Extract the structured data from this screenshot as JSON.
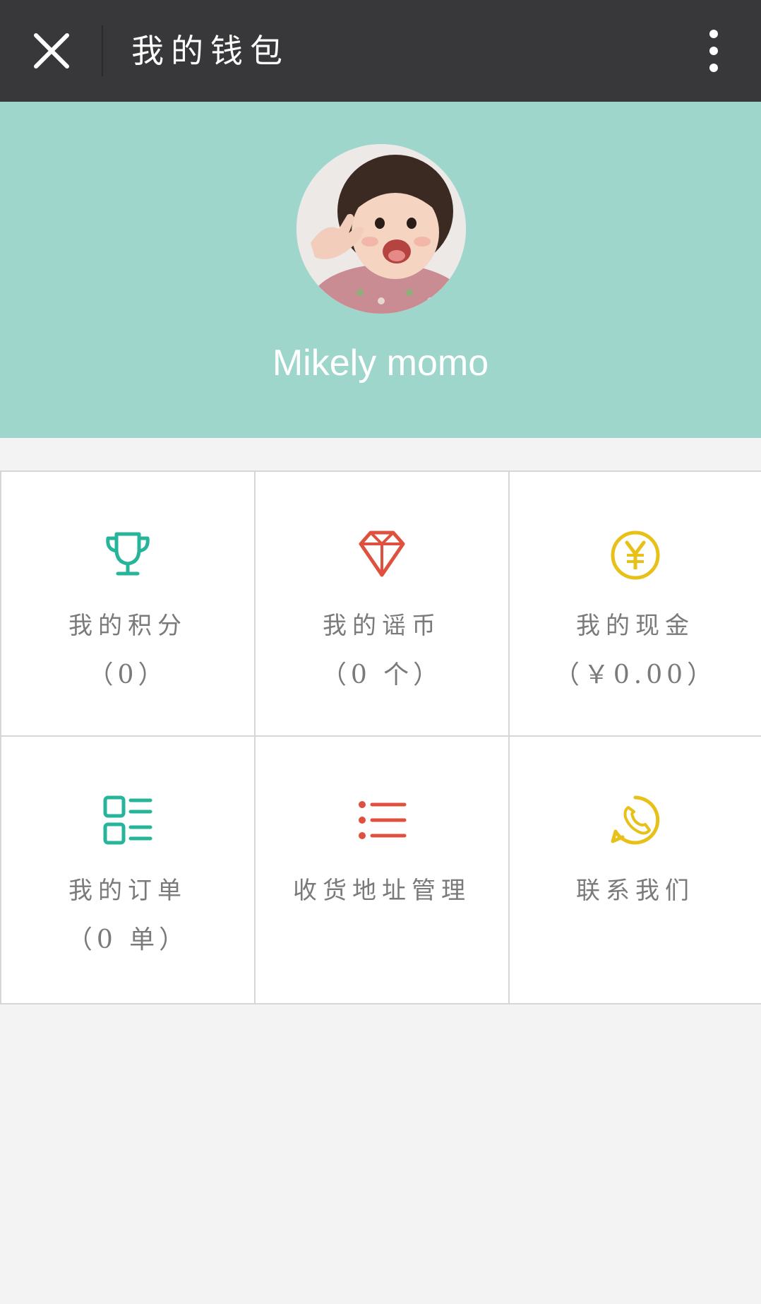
{
  "header": {
    "title": "我的钱包"
  },
  "profile": {
    "username": "Mikely momo"
  },
  "grid": [
    {
      "label": "我的积分",
      "sub": "（0）",
      "icon": "trophy-icon",
      "color": "#26b59a"
    },
    {
      "label": "我的谣币",
      "sub": "（0 个）",
      "icon": "diamond-icon",
      "color": "#e0503f"
    },
    {
      "label": "我的现金",
      "sub": "（￥0.00）",
      "icon": "yen-coin-icon",
      "color": "#e8c118"
    },
    {
      "label": "我的订单",
      "sub": "（0 单）",
      "icon": "order-list-icon",
      "color": "#26b59a"
    },
    {
      "label": "收货地址管理",
      "sub": "",
      "icon": "list-icon",
      "color": "#e0503f"
    },
    {
      "label": "联系我们",
      "sub": "",
      "icon": "phone-icon",
      "color": "#e8c118"
    }
  ],
  "colors": {
    "topbar": "#38383a",
    "profile_bg": "#9fd6cc",
    "page_bg": "#f3f3f3",
    "text_gray": "#7a7a7a"
  }
}
